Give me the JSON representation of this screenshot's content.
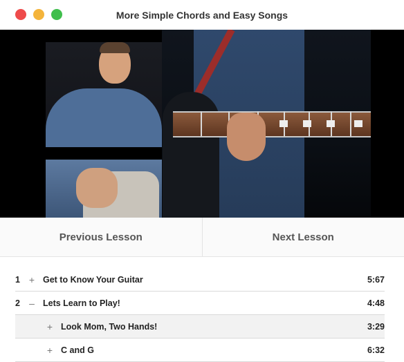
{
  "window": {
    "title": "More Simple Chords and Easy Songs",
    "controls": [
      "close",
      "minimize",
      "zoom"
    ],
    "control_colors": {
      "close": "#ee4b4b",
      "minimize": "#f4b43b",
      "zoom": "#3fbe4c"
    }
  },
  "video": {
    "content": "lesson-video-player"
  },
  "navigation": {
    "previous_label": "Previous Lesson",
    "next_label": "Next Lesson"
  },
  "lessons": [
    {
      "number": "1",
      "toggle": "+",
      "title": "Get to Know Your Guitar",
      "duration": "5:67"
    },
    {
      "number": "2",
      "toggle": "–",
      "title": "Lets Learn to Play!",
      "duration": "4:48",
      "children": [
        {
          "toggle": "+",
          "title": "Look Mom, Two Hands!",
          "duration": "3:29",
          "active": true
        },
        {
          "toggle": "+",
          "title": "C and G",
          "duration": "6:32"
        }
      ]
    }
  ]
}
